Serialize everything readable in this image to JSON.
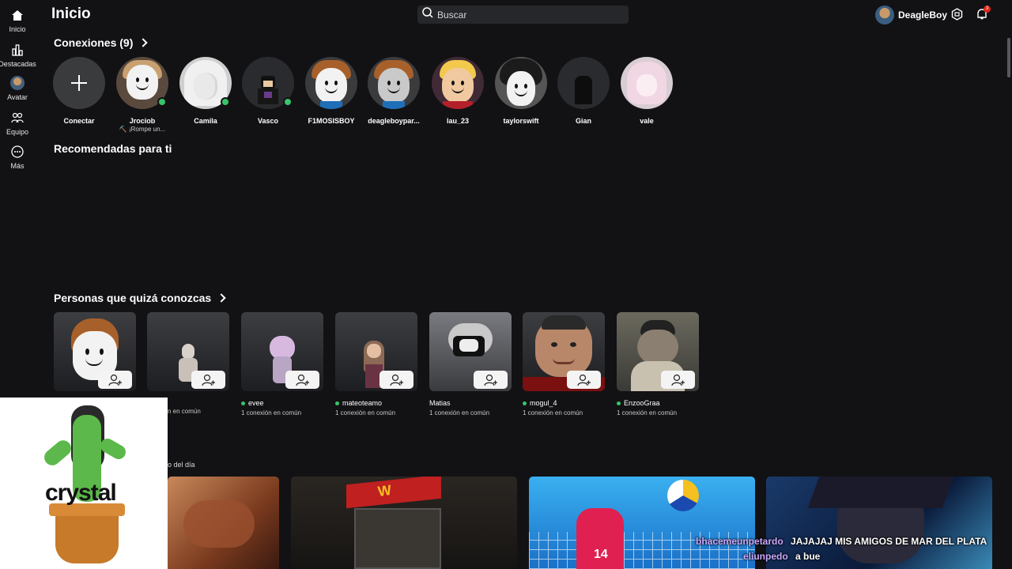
{
  "sidebar": {
    "items": [
      {
        "label": "Inicio",
        "icon": "home-icon"
      },
      {
        "label": "Destacadas",
        "icon": "charts-icon"
      },
      {
        "label": "Avatar",
        "icon": "avatar-icon"
      },
      {
        "label": "Equipo",
        "icon": "team-icon"
      },
      {
        "label": "Más",
        "icon": "more-icon"
      }
    ]
  },
  "header": {
    "title": "Inicio",
    "search_placeholder": "Buscar",
    "username": "DeagleBoy",
    "notification_count": "3"
  },
  "connections": {
    "title": "Conexiones (9)",
    "items": [
      {
        "name": "Conectar",
        "sub": ""
      },
      {
        "name": "Jrociob",
        "sub": "⛏️ ¡Rompe un...",
        "online": true
      },
      {
        "name": "Camila",
        "sub": "",
        "online": true
      },
      {
        "name": "Vasco",
        "sub": "",
        "online": true
      },
      {
        "name": "F1MOSISBOY",
        "sub": ""
      },
      {
        "name": "deagleboypar...",
        "sub": ""
      },
      {
        "name": "lau_23",
        "sub": ""
      },
      {
        "name": "taylorswift",
        "sub": ""
      },
      {
        "name": "Gian",
        "sub": ""
      },
      {
        "name": "vale",
        "sub": ""
      }
    ]
  },
  "recommended": {
    "title": "Recomendadas para ti"
  },
  "people": {
    "title": "Personas que quizá conozcas",
    "items": [
      {
        "name": "",
        "mutual": ""
      },
      {
        "name": "",
        "mutual": "1 conexión en común"
      },
      {
        "name": "evee",
        "mutual": "1 conexión en común",
        "online": true
      },
      {
        "name": "mateoteamo",
        "mutual": "1 conexión en común",
        "online": true
      },
      {
        "name": "Matias",
        "mutual": "1 conexión en común"
      },
      {
        "name": "mogul_4",
        "mutual": "1 conexión en común",
        "online": true
      },
      {
        "name": "EnzooGraa",
        "mutual": "1 conexión en común",
        "online": true
      }
    ],
    "partial_mutual": "n en común"
  },
  "games": {
    "label": "o del día"
  },
  "overlay": {
    "sticker_text": "crystal",
    "chat": [
      {
        "user": "bhacemeunpetardo",
        "message": "JAJAJAJ MIS AMIGOS DE MAR DEL PLATA"
      },
      {
        "user": "eliunpedo",
        "message": "a bue"
      }
    ]
  },
  "colors": {
    "background": "#121215",
    "online": "#39c46b",
    "card": "#393b3d"
  }
}
